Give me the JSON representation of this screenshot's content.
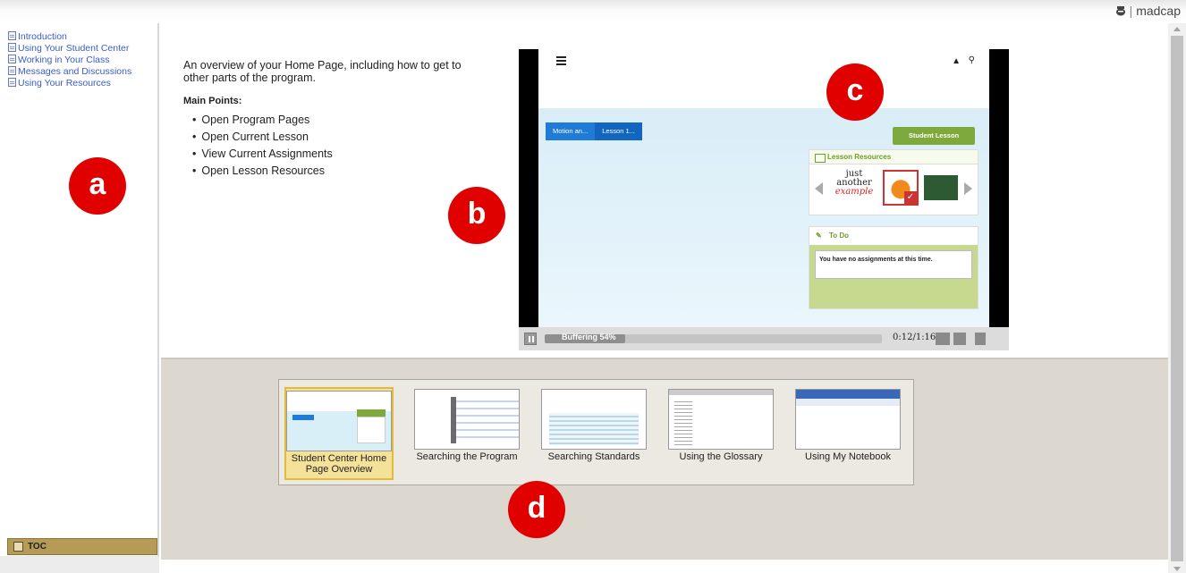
{
  "brand": {
    "name": "madcap",
    "icon": "madcap-logo-icon"
  },
  "toc": {
    "items": [
      {
        "label": "Introduction"
      },
      {
        "label": "Using Your Student Center"
      },
      {
        "label": "Working in Your Class"
      },
      {
        "label": "Messages and Discussions"
      },
      {
        "label": "Using Your Resources"
      }
    ],
    "tab_label": "TOC"
  },
  "badges": {
    "a": "a",
    "b": "b",
    "c": "c",
    "d": "d"
  },
  "overview": {
    "description": "An overview of your Home Page, including how to get to other parts of the program.",
    "main_points_label": "Main Points:",
    "points": [
      "Open Program Pages",
      "Open Current Lesson",
      "View Current Assignments",
      "Open Lesson Resources"
    ]
  },
  "video": {
    "menu_label": "menu",
    "breadcrumb": [
      "Motion an...",
      "Lesson 1..."
    ],
    "student_lesson": "Student Lesson",
    "lesson_resources": "Lesson Resources",
    "example_text": [
      "just",
      "another",
      "example"
    ],
    "todo_title": "To Do",
    "todo_message": "You have no assignments at this time.",
    "buffering": "Buffering 54%",
    "buffer_progress": 0.24,
    "time": "0:12/1:16"
  },
  "gallery": {
    "items": [
      {
        "caption": "Student Center Home Page Overview",
        "selected": true
      },
      {
        "caption": "Searching the Program",
        "selected": false
      },
      {
        "caption": "Searching Standards",
        "selected": false
      },
      {
        "caption": "Using the Glossary",
        "selected": false
      },
      {
        "caption": "Using My Notebook",
        "selected": false
      }
    ]
  },
  "colors": {
    "link": "#3a5cc6",
    "badge": "#e10000",
    "accent_green": "#7ea93c",
    "toc_bar": "#b69b56"
  }
}
